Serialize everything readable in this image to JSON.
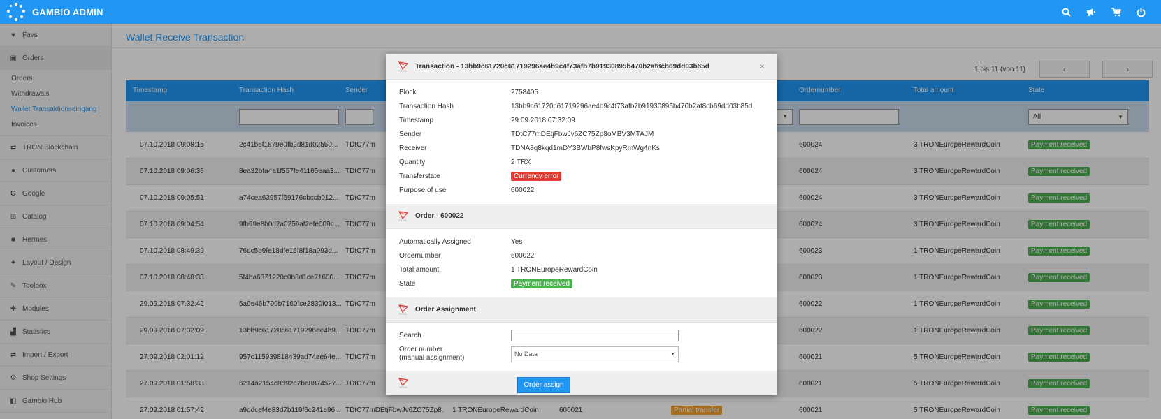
{
  "app": {
    "title": "GAMBIO ADMIN"
  },
  "sidebar": {
    "items": [
      {
        "label": "Favs",
        "icon": "heart-icon"
      },
      {
        "label": "Orders",
        "icon": "cart-icon"
      },
      {
        "label": "TRON Blockchain",
        "icon": "exchange-icon"
      },
      {
        "label": "Customers",
        "icon": "users-icon"
      },
      {
        "label": "Google",
        "icon": "google-icon"
      },
      {
        "label": "Catalog",
        "icon": "sitemap-icon"
      },
      {
        "label": "Hermes",
        "icon": "truck-icon"
      },
      {
        "label": "Layout / Design",
        "icon": "magic-icon"
      },
      {
        "label": "Toolbox",
        "icon": "wrench-icon"
      },
      {
        "label": "Modules",
        "icon": "puzzle-icon"
      },
      {
        "label": "Statistics",
        "icon": "chart-icon"
      },
      {
        "label": "Import / Export",
        "icon": "exchange-icon"
      },
      {
        "label": "Shop Settings",
        "icon": "gears-icon"
      },
      {
        "label": "Gambio Hub",
        "icon": "hub-icon"
      }
    ],
    "orders_sub": [
      "Orders",
      "Withdrawals",
      "Wallet Transaktionseingang",
      "Invoices"
    ]
  },
  "main": {
    "title": "Wallet Receive Transaction",
    "pager_text": "1 bis 11 (von 11)",
    "columns": [
      "Timestamp",
      "Transaction Hash",
      "Sender",
      "Ordernumber",
      "Total amount",
      "State"
    ],
    "state_filter": "All",
    "rows": [
      {
        "ts": "07.10.2018 09:08:15",
        "hash": "2c41b5f1879e0fb2d81d02550...",
        "sender": "TDtC77m",
        "order": "600024",
        "amount": "3 TRONEuropeRewardCoin",
        "state": "Payment received"
      },
      {
        "ts": "07.10.2018 09:06:36",
        "hash": "8ea32bfa4a1f557fe41165eaa3...",
        "sender": "TDtC77m",
        "order": "600024",
        "amount": "3 TRONEuropeRewardCoin",
        "state": "Payment received"
      },
      {
        "ts": "07.10.2018 09:05:51",
        "hash": "a74cea63957f69176cbccb012...",
        "sender": "TDtC77m",
        "order": "600024",
        "amount": "3 TRONEuropeRewardCoin",
        "state": "Payment received"
      },
      {
        "ts": "07.10.2018 09:04:54",
        "hash": "9fb99e8b0d2a0259af2efe009c...",
        "sender": "TDtC77m",
        "order": "600024",
        "amount": "3 TRONEuropeRewardCoin",
        "state": "Payment received"
      },
      {
        "ts": "07.10.2018 08:49:39",
        "hash": "76dc5b9fe18dfe15f8f18a093d...",
        "sender": "TDtC77m",
        "order": "600023",
        "amount": "1 TRONEuropeRewardCoin",
        "state": "Payment received"
      },
      {
        "ts": "07.10.2018 08:48:33",
        "hash": "5f4ba6371220c0b8d1ce71600...",
        "sender": "TDtC77m",
        "order": "600023",
        "amount": "1 TRONEuropeRewardCoin",
        "state": "Payment received"
      },
      {
        "ts": "29.09.2018 07:32:42",
        "hash": "6a9e46b799b7160fce2830f013...",
        "sender": "TDtC77m",
        "order": "600022",
        "amount": "1 TRONEuropeRewardCoin",
        "state": "Payment received"
      },
      {
        "ts": "29.09.2018 07:32:09",
        "hash": "13bb9c61720c61719296ae4b9...",
        "sender": "TDtC77m",
        "order": "600022",
        "amount": "1 TRONEuropeRewardCoin",
        "state": "Payment received"
      },
      {
        "ts": "27.09.2018 02:01:12",
        "hash": "957c115939818439ad74ae64e...",
        "sender": "TDtC77m",
        "order": "600021",
        "amount": "5 TRONEuropeRewardCoin",
        "state": "Payment received"
      },
      {
        "ts": "27.09.2018 01:58:33",
        "hash": "6214a2154c8d92e7be8874527...",
        "sender": "TDtC77m",
        "order": "600021",
        "amount": "5 TRONEuropeRewardCoin",
        "state": "Payment received"
      },
      {
        "ts": "27.09.2018 01:57:42",
        "hash": "a9ddcef4e83d7b119f6c241e96...",
        "sender": "TDtC77mDEtjFbwJv6ZC75Zp8...",
        "quantity": "1 TRONEuropeRewardCoin",
        "purpose": "600021",
        "transferstate": "Partial transfer",
        "order": "600021",
        "amount": "5 TRONEuropeRewardCoin",
        "state": "Payment received"
      }
    ]
  },
  "modal": {
    "title": "Transaction - 13bb9c61720c61719296ae4b9c4f73afb7b91930895b470b2af8cb69dd03b85d",
    "logo_label": "TRON",
    "close": "×",
    "transaction": [
      {
        "k": "Block",
        "v": "2758405"
      },
      {
        "k": "Transaction Hash",
        "v": "13bb9c61720c61719296ae4b9c4f73afb7b91930895b470b2af8cb69dd03b85d"
      },
      {
        "k": "Timestamp",
        "v": "29.09.2018 07:32:09"
      },
      {
        "k": "Sender",
        "v": "TDtC77mDEtjFbwJv6ZC75Zp8oMBV3MTAJM"
      },
      {
        "k": "Receiver",
        "v": "TDNA8q8kqd1mDY3BWbP8fwsKpyRmWg4nKs"
      },
      {
        "k": "Quantity",
        "v": "2 TRX"
      },
      {
        "k": "Transferstate",
        "v": "Currency error"
      },
      {
        "k": "Purpose of use",
        "v": "600022"
      }
    ],
    "order_title": "Order - 600022",
    "order": [
      {
        "k": "Automatically Assigned",
        "v": "Yes"
      },
      {
        "k": "Ordernumber",
        "v": "600022"
      },
      {
        "k": "Total amount",
        "v": "1 TRONEuropeRewardCoin"
      },
      {
        "k": "State",
        "v": "Payment received"
      }
    ],
    "assign_title": "Order Assignment",
    "search_label": "Search",
    "order_number_label": "Order number",
    "manual_label": "(manual assignment)",
    "select_value": "No Data",
    "assign_button": "Order assign"
  },
  "colors": {
    "primary": "#2196f3",
    "success": "#4caf50",
    "warning": "#f0a030",
    "danger": "#e03c31"
  }
}
